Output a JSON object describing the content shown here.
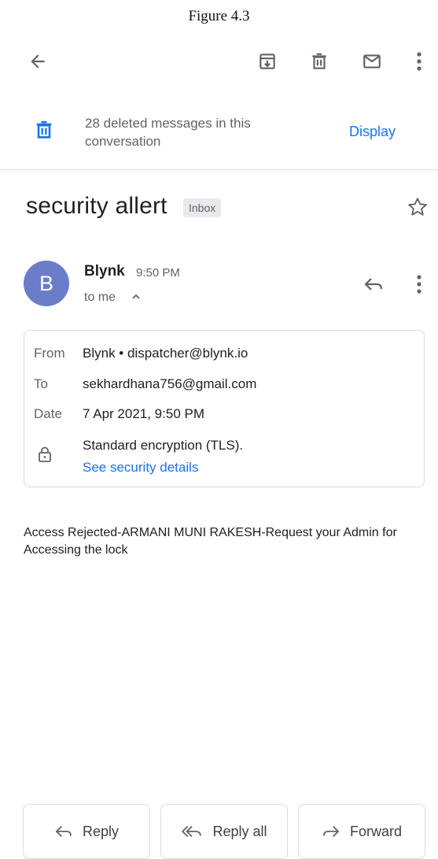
{
  "caption": "Figure 4.3",
  "toolbar": {
    "back_icon": "arrow-back-icon",
    "archive_icon": "archive-icon",
    "delete_icon": "trash-icon",
    "mark_unread_icon": "envelope-icon",
    "more_icon": "more-vert-icon"
  },
  "banner": {
    "icon": "trash-icon",
    "text": "28 deleted messages in this conversation",
    "action_label": "Display",
    "accent": "#1a73e8"
  },
  "subject": {
    "title": "security allert",
    "label_chip": "Inbox"
  },
  "message": {
    "avatar_letter": "B",
    "avatar_color": "#6b7dc9",
    "sender_name": "Blynk",
    "time": "9:50 PM",
    "recipient_line": "to me",
    "details": {
      "from_label": "From",
      "from_value": "Blynk • dispatcher@blynk.io",
      "to_label": "To",
      "to_value": "sekhardhana756@gmail.com",
      "date_label": "Date",
      "date_value": "7 Apr 2021, 9:50 PM",
      "encryption_text": "Standard encryption (TLS).",
      "security_link": "See security details"
    },
    "body": "Access Rejected-ARMANI MUNI RAKESH-Request your Admin for Accessing the lock"
  },
  "actions": {
    "reply_label": "Reply",
    "reply_all_label": "Reply all",
    "forward_label": "Forward"
  }
}
